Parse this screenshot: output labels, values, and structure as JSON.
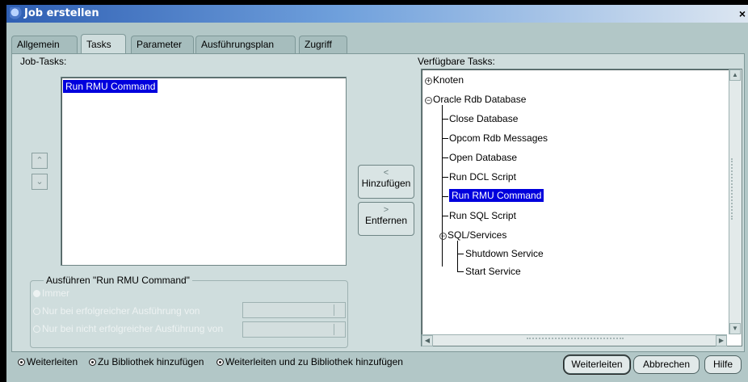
{
  "window": {
    "title": "Job erstellen",
    "close": "×"
  },
  "tabs": [
    {
      "label": "Allgemein"
    },
    {
      "label": "Tasks"
    },
    {
      "label": "Parameter"
    },
    {
      "label": "Ausführungsplan"
    },
    {
      "label": "Zugriff"
    }
  ],
  "active_tab": "Tasks",
  "job_tasks": {
    "label": "Job-Tasks:",
    "items": [
      "Run RMU Command"
    ],
    "move_up_icon": "⌃",
    "move_down_icon": "⌄"
  },
  "center_buttons": {
    "add_icon": "<",
    "add": "Hinzufügen",
    "remove_icon": ">",
    "remove": "Entfernen"
  },
  "execute_group": {
    "title": "Ausführen \"Run RMU Command\"",
    "options": [
      {
        "label": "Immer",
        "selected": true
      },
      {
        "label": "Nur bei erfolgreicher Ausführung von",
        "selected": false
      },
      {
        "label": "Nur bei nicht erfolgreicher Ausführung von",
        "selected": false
      }
    ]
  },
  "available_tasks": {
    "label": "Verfügbare Tasks:",
    "tree": {
      "knoten": "Knoten",
      "oracle_rdb": "Oracle Rdb Database",
      "children": [
        "Close Database",
        "Opcom Rdb Messages",
        "Open Database",
        "Run DCL Script",
        "Run RMU Command",
        "Run SQL Script"
      ],
      "selected": "Run RMU Command",
      "sql_services": "SQL/Services",
      "sql_children": [
        "Shutdown Service",
        "Start Service"
      ]
    }
  },
  "bottom_options": [
    {
      "label": "Weiterleiten",
      "selected": true
    },
    {
      "label": "Zu Bibliothek hinzufügen",
      "selected": true
    },
    {
      "label": "Weiterleiten und zu Bibliothek hinzufügen",
      "selected": true
    }
  ],
  "buttons": {
    "submit": "Weiterleiten",
    "cancel": "Abbrechen",
    "help": "Hilfe"
  },
  "colors": {
    "selection": "#0000dd",
    "dialog_bg": "#b2c7c7",
    "panel_bg": "#cfdddd"
  }
}
